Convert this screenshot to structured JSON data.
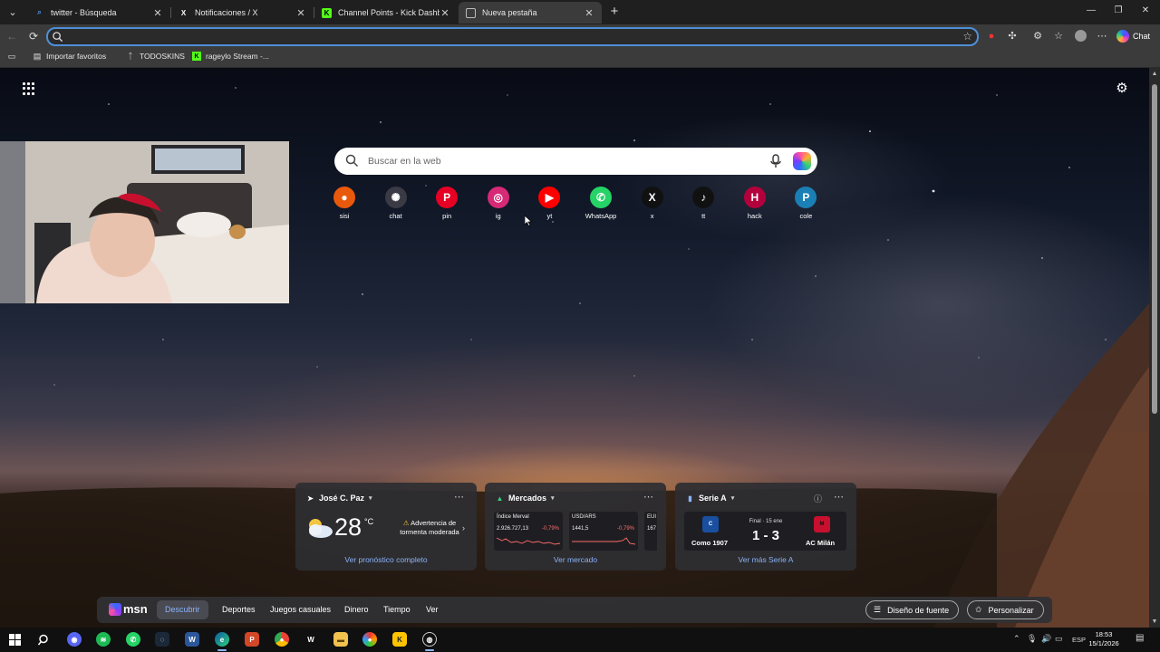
{
  "browser": {
    "tabs": [
      {
        "title": "twitter - Búsqueda",
        "favicon": "search-favicon",
        "active": false
      },
      {
        "title": "Notificaciones / X",
        "favicon": "x-favicon",
        "active": false
      },
      {
        "title": "Channel Points - Kick Dashboard",
        "favicon": "kick-favicon",
        "active": false
      },
      {
        "title": "Nueva pestaña",
        "favicon": "edge-newtab-favicon",
        "active": true
      }
    ],
    "address_value": "",
    "copilot_label": "Chat",
    "favorites": [
      {
        "label": "Importar favoritos",
        "icon": "folder-import-icon"
      },
      {
        "label": "TODOSKINS",
        "icon": "todoskins-icon"
      },
      {
        "label": "rageylo Stream -...",
        "icon": "kick-favicon"
      }
    ]
  },
  "newtab": {
    "search_placeholder": "Buscar en la web",
    "quicklinks": [
      {
        "label": "sisi",
        "color": "#e8590c",
        "glyph": "●"
      },
      {
        "label": "chat",
        "color": "#3a3a44",
        "glyph": "✺"
      },
      {
        "label": "pin",
        "color": "#e60023",
        "glyph": "P"
      },
      {
        "label": "ig",
        "color": "#d62976",
        "glyph": "◎"
      },
      {
        "label": "yt",
        "color": "#ff0000",
        "glyph": "▶"
      },
      {
        "label": "WhatsApp",
        "color": "#25d366",
        "glyph": "✆"
      },
      {
        "label": "x",
        "color": "#111111",
        "glyph": "X"
      },
      {
        "label": "tt",
        "color": "#111111",
        "glyph": "♪"
      },
      {
        "label": "hack",
        "color": "#b3003c",
        "glyph": "H"
      },
      {
        "label": "cole",
        "color": "#1a7fb5",
        "glyph": "P"
      }
    ]
  },
  "widgets": {
    "weather": {
      "location": "José C. Paz",
      "temperature": "28",
      "unit": "°C",
      "alert": "Advertencia de tormenta moderada",
      "link": "Ver pronóstico completo"
    },
    "markets": {
      "title": "Mercados",
      "items": [
        {
          "name": "Índice Merval",
          "value": "2.926.727,13",
          "change": "-0,79%"
        },
        {
          "name": "USD/ARS",
          "value": "1441,5",
          "change": "-0,79%"
        },
        {
          "name": "EUI",
          "value": "167",
          "change": ""
        }
      ],
      "link": "Ver mercado"
    },
    "sports": {
      "title": "Serie A",
      "home_team": "Como 1907",
      "away_team": "AC Milán",
      "status": "Final · 15 ene",
      "score": "1 - 3",
      "link": "Ver más Serie A"
    }
  },
  "msn": {
    "logo": "msn",
    "nav": [
      "Descubrir",
      "Deportes",
      "Juegos casuales",
      "Dinero",
      "Tiempo",
      "Ver"
    ],
    "active_nav": "Descubrir",
    "font_button": "Diseño de fuente",
    "personalize_button": "Personalizar"
  },
  "taskbar": {
    "language": "ESP",
    "time": "18:53",
    "date": "15/1/2026"
  }
}
